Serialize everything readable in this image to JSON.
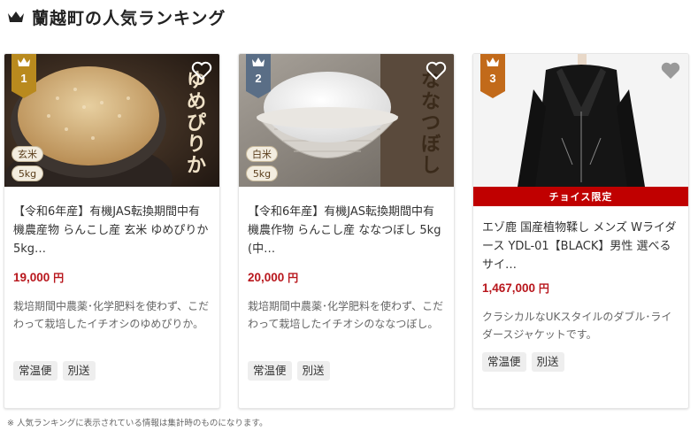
{
  "header": {
    "title": "蘭越町の人気ランキング",
    "crown_icon": "crown-icon"
  },
  "cards": [
    {
      "rank": "1",
      "badge_color": "#b98a1e",
      "image_text_vertical": "ゆめぴりか",
      "image_label_kind": "玄米",
      "image_label_weight": "5kg",
      "name": "【令和6年産】有機JAS転換期間中有機農産物 らんこし産 玄米 ゆめぴりか 5kg…",
      "price_value": "19,000",
      "price_unit": "円",
      "description": "栽培期間中農薬･化学肥料を使わず、こだわって栽培したイチオシのゆめぴりか。",
      "tags": [
        "常温便",
        "別送"
      ]
    },
    {
      "rank": "2",
      "badge_color": "#5a6e86",
      "image_text_vertical": "ななつぼし",
      "image_label_kind": "白米",
      "image_label_weight": "5kg",
      "name": "【令和6年産】有機JAS転換期間中有機農作物 らんこし産 ななつぼし 5kg (中…",
      "price_value": "20,000",
      "price_unit": "円",
      "description": "栽培期間中農薬･化学肥料を使わず、こだわって栽培したイチオシのななつぼし。",
      "tags": [
        "常温便",
        "別送"
      ]
    },
    {
      "rank": "3",
      "badge_color": "#c26a1a",
      "choice_label": "チョイス限定",
      "name": "エゾ鹿 国産植物鞣し メンズ Wライダース YDL-01【BLACK】男性 選べるサイ…",
      "price_value": "1,467,000",
      "price_unit": "円",
      "description": "クラシカルなUKスタイルのダブル･ライダースジャケットです。",
      "tags": [
        "常温便",
        "別送"
      ]
    }
  ],
  "footnote": "※ 人気ランキングに表示されている情報は集計時のものになります。"
}
